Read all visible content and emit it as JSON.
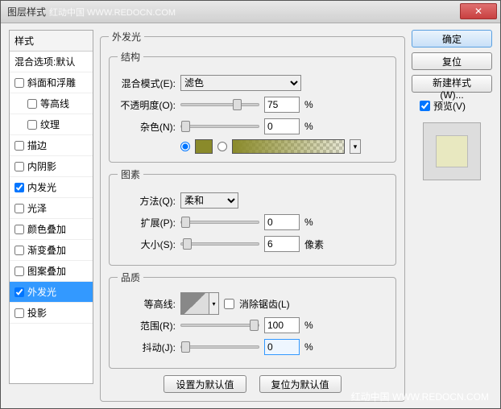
{
  "titlebar": {
    "title": "图层样式",
    "close_icon": "✕"
  },
  "watermark": {
    "top": "红动中国  WWW.REDOCN.COM",
    "bottom": "红动中国 WWW.REDOCN.COM"
  },
  "sidebar": {
    "header": "样式",
    "items": [
      {
        "label": "混合选项:默认",
        "checkbox": false,
        "checked": false,
        "level": 1
      },
      {
        "label": "斜面和浮雕",
        "checkbox": true,
        "checked": false,
        "level": 1
      },
      {
        "label": "等高线",
        "checkbox": true,
        "checked": false,
        "level": 2
      },
      {
        "label": "纹理",
        "checkbox": true,
        "checked": false,
        "level": 2
      },
      {
        "label": "描边",
        "checkbox": true,
        "checked": false,
        "level": 1
      },
      {
        "label": "内阴影",
        "checkbox": true,
        "checked": false,
        "level": 1
      },
      {
        "label": "内发光",
        "checkbox": true,
        "checked": true,
        "level": 1
      },
      {
        "label": "光泽",
        "checkbox": true,
        "checked": false,
        "level": 1
      },
      {
        "label": "颜色叠加",
        "checkbox": true,
        "checked": false,
        "level": 1
      },
      {
        "label": "渐变叠加",
        "checkbox": true,
        "checked": false,
        "level": 1
      },
      {
        "label": "图案叠加",
        "checkbox": true,
        "checked": false,
        "level": 1
      },
      {
        "label": "外发光",
        "checkbox": true,
        "checked": true,
        "level": 1,
        "selected": true
      },
      {
        "label": "投影",
        "checkbox": true,
        "checked": false,
        "level": 1
      }
    ]
  },
  "main": {
    "panel_title": "外发光",
    "structure": {
      "legend": "结构",
      "blend_mode_label": "混合模式(E):",
      "blend_mode_value": "滤色",
      "opacity_label": "不透明度(O):",
      "opacity_value": "75",
      "opacity_unit": "%",
      "noise_label": "杂色(N):",
      "noise_value": "0",
      "noise_unit": "%",
      "solid_color": "#8a8a2a"
    },
    "elements": {
      "legend": "图素",
      "technique_label": "方法(Q):",
      "technique_value": "柔和",
      "spread_label": "扩展(P):",
      "spread_value": "0",
      "spread_unit": "%",
      "size_label": "大小(S):",
      "size_value": "6",
      "size_unit": "像素"
    },
    "quality": {
      "legend": "品质",
      "contour_label": "等高线:",
      "antialias_label": "消除锯齿(L)",
      "range_label": "范围(R):",
      "range_value": "100",
      "range_unit": "%",
      "jitter_label": "抖动(J):",
      "jitter_value": "0",
      "jitter_unit": "%"
    },
    "buttons": {
      "set_default": "设置为默认值",
      "reset_default": "复位为默认值"
    }
  },
  "right": {
    "ok": "确定",
    "cancel": "复位",
    "new_style": "新建样式(W)...",
    "preview_label": "预览(V)"
  }
}
